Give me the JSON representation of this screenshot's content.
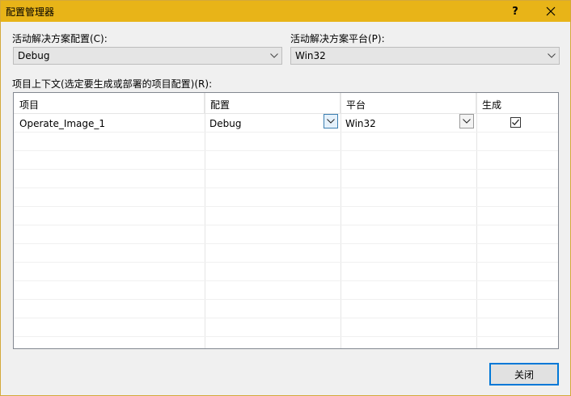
{
  "window": {
    "title": "配置管理器",
    "help_glyph": "?",
    "close_glyph": "✕"
  },
  "solution_config": {
    "label": "活动解决方案配置(C):",
    "value": "Debug"
  },
  "solution_platform": {
    "label": "活动解决方案平台(P):",
    "value": "Win32"
  },
  "project_context": {
    "label": "项目上下文(选定要生成或部署的项目配置)(R):",
    "columns": [
      "项目",
      "配置",
      "平台",
      "生成"
    ],
    "rows": [
      {
        "project": "Operate_Image_1",
        "config": "Debug",
        "platform": "Win32",
        "build": true
      }
    ]
  },
  "buttons": {
    "close_label": "关闭"
  },
  "colors": {
    "titlebar": "#e8b418",
    "dialog_bg": "#f0f0f0",
    "focus_border": "#0078d7"
  },
  "icons": {
    "combo_arrow": "chevron-down-icon",
    "check": "checkmark-icon"
  }
}
